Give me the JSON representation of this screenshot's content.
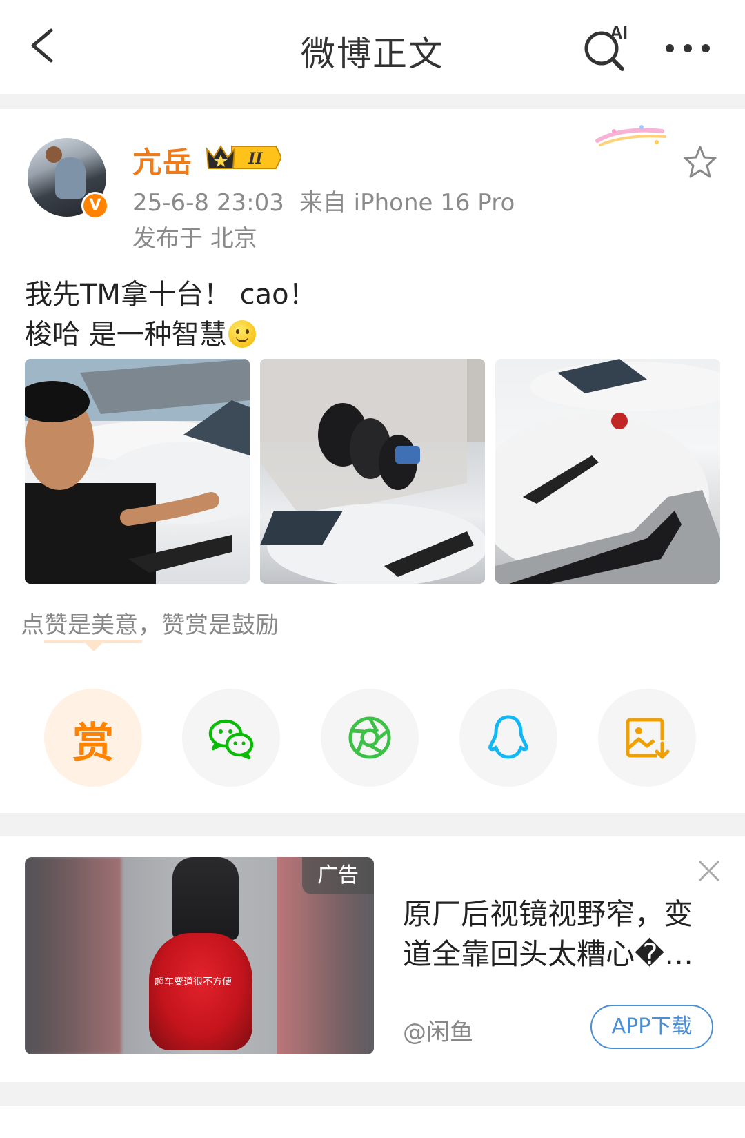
{
  "header": {
    "title": "微博正文",
    "ai_label": "AI"
  },
  "post": {
    "author": "亢岳",
    "verified_mark": "V",
    "vip_level": "II",
    "timestamp": "25-6-8 23:03",
    "source": "来自 iPhone 16 Pro",
    "location": "发布于 北京",
    "text_line1": "我先TM拿十台！ cao！",
    "text_line2": "梭哈 是一种智慧",
    "photos": [
      "photo-1",
      "photo-2",
      "photo-3"
    ]
  },
  "reward": {
    "prompt": "点赞是美意，赞赏是鼓励",
    "reward_label": "赏"
  },
  "share": {
    "items": [
      "reward",
      "wechat",
      "wechat-moments",
      "qq",
      "save-image"
    ]
  },
  "ad": {
    "tag": "广告",
    "title": "原厂后视镜视野窄，变道全靠回头太糟心�…",
    "image_caption": "超车变道很不方便",
    "source": "@闲鱼",
    "button_label": "APP下载"
  },
  "colors": {
    "accent_orange": "#ff8200",
    "username_orange": "#ee7c1a",
    "wechat_green": "#09bb07",
    "qq_blue": "#12b7f5",
    "link_blue": "#4a8fd6"
  }
}
